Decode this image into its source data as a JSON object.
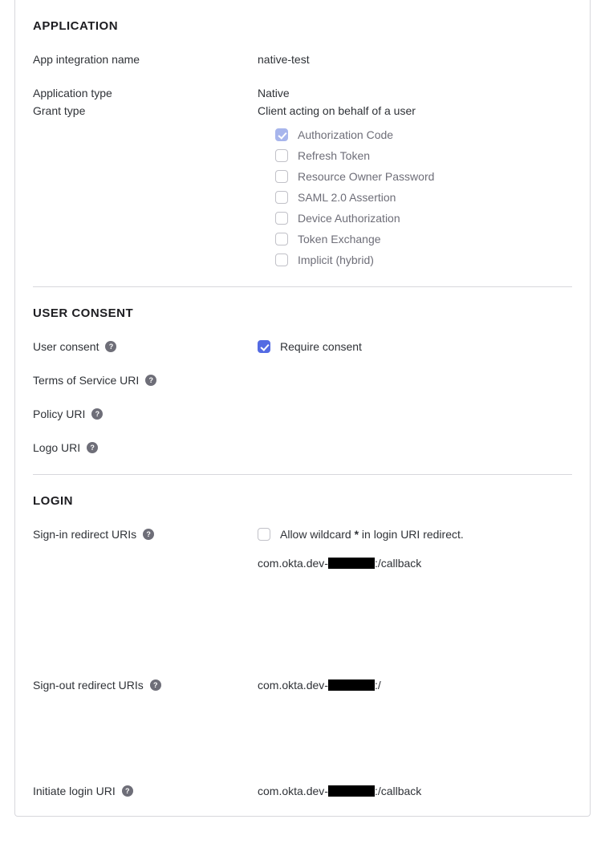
{
  "application": {
    "heading": "APPLICATION",
    "app_name_label": "App integration name",
    "app_name_value": "native-test",
    "app_type_label": "Application type",
    "app_type_value": "Native",
    "grant_type_label": "Grant type",
    "grant_group_label": "Client acting on behalf of a user",
    "grants": [
      {
        "label": "Authorization Code",
        "checked": true
      },
      {
        "label": "Refresh Token",
        "checked": false
      },
      {
        "label": "Resource Owner Password",
        "checked": false
      },
      {
        "label": "SAML 2.0 Assertion",
        "checked": false
      },
      {
        "label": "Device Authorization",
        "checked": false
      },
      {
        "label": "Token Exchange",
        "checked": false
      },
      {
        "label": "Implicit (hybrid)",
        "checked": false
      }
    ]
  },
  "user_consent": {
    "heading": "USER CONSENT",
    "consent_label": "User consent",
    "require_consent_label": "Require consent",
    "require_consent_checked": true,
    "tos_label": "Terms of Service URI",
    "policy_label": "Policy URI",
    "logo_label": "Logo URI"
  },
  "login": {
    "heading": "LOGIN",
    "signin_label": "Sign-in redirect URIs",
    "wildcard_pre": "Allow wildcard ",
    "wildcard_star": "*",
    "wildcard_post": " in login URI redirect.",
    "wildcard_checked": false,
    "signin_uri_pre": "com.okta.dev-",
    "signin_uri_post": ":/callback",
    "signout_label": "Sign-out redirect URIs",
    "signout_uri_pre": "com.okta.dev-",
    "signout_uri_post": ":/",
    "initiate_label": "Initiate login URI",
    "initiate_uri_pre": "com.okta.dev-",
    "initiate_uri_post": ":/callback"
  }
}
